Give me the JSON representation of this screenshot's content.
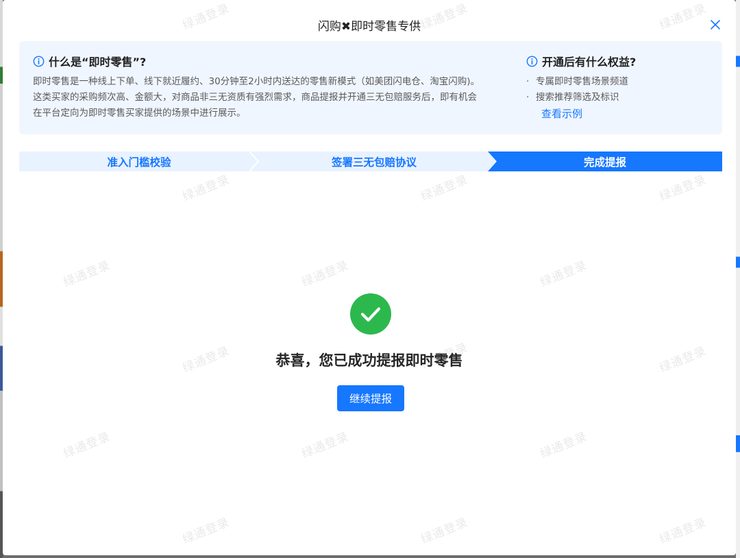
{
  "modal": {
    "title": "闪购✖即时零售专供",
    "close_icon": "close-icon"
  },
  "watermark": {
    "text": "绿通登录"
  },
  "info": {
    "what_title": "什么是“即时零售”?",
    "what_body": "即时零售是一种线上下单、线下就近履约、30分钟至2小时内送达的零售新模式（如美团闪电仓、淘宝闪购)。这类买家的采购频次高、金额大，对商品非三无资质有强烈需求，商品提报并开通三无包赔服务后，即有机会在平台定向为即时零售买家提供的场景中进行展示。",
    "benefits_title": "开通后有什么权益?",
    "benefits": [
      "专属即时零售场景频道",
      "搜索推荐筛选及标识"
    ],
    "example_link": "查看示例",
    "icon": "info-circle-icon"
  },
  "steps": [
    {
      "label": "准入门槛校验",
      "state": "done"
    },
    {
      "label": "签署三无包赔协议",
      "state": "done"
    },
    {
      "label": "完成提报",
      "state": "active"
    }
  ],
  "result": {
    "icon": "check-circle-icon",
    "message": "恭喜，您已成功提报即时零售",
    "continue_button": "继续提报"
  },
  "colors": {
    "primary": "#1677ff",
    "success": "#2db84d",
    "panel_bg": "#f0f6ff",
    "step_inactive_bg": "#e9f2ff"
  }
}
